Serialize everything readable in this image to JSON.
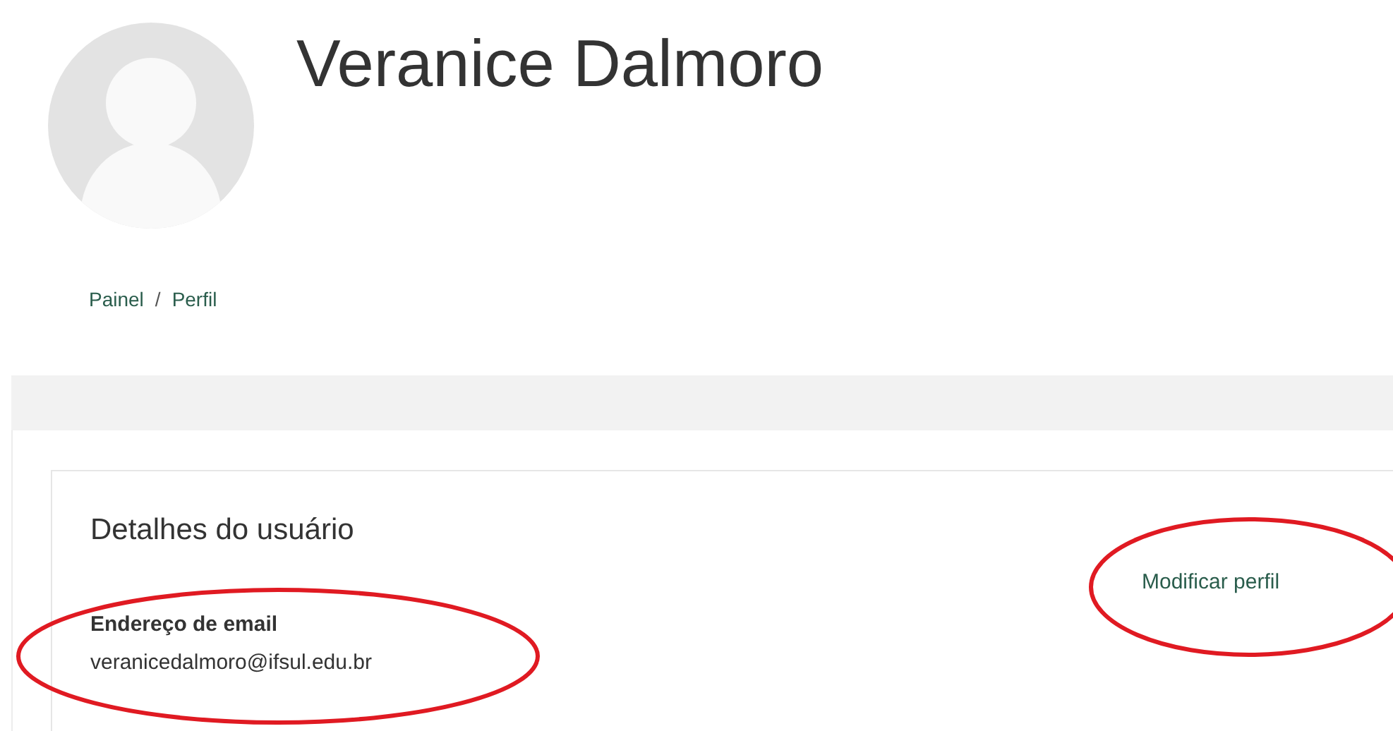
{
  "profile": {
    "name": "Veranice Dalmoro"
  },
  "breadcrumb": [
    {
      "label": "Painel"
    },
    {
      "label": "Perfil"
    }
  ],
  "breadcrumb_separator": "/",
  "card": {
    "title": "Detalhes do usuário",
    "edit_link": "Modificar perfil",
    "fields": [
      {
        "label": "Endereço de email",
        "value": "veranicedalmoro@ifsul.edu.br"
      }
    ]
  }
}
